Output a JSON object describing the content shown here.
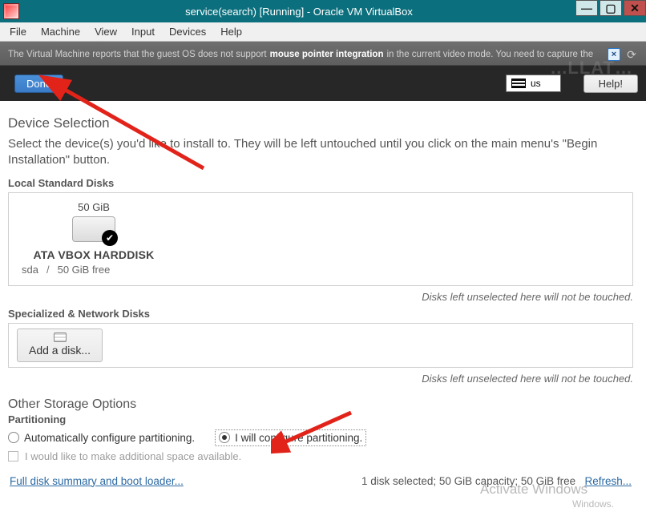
{
  "window": {
    "title": "service(search) [Running] - Oracle VM VirtualBox",
    "controls": {
      "min": "—",
      "max": "▢",
      "close": "✕"
    }
  },
  "menubar": {
    "items": [
      "File",
      "Machine",
      "View",
      "Input",
      "Devices",
      "Help"
    ]
  },
  "infobar": {
    "pre": "The Virtual Machine reports that the guest OS does not support ",
    "bold": "mouse pointer integration",
    "post": " in the current video mode. You need to capture the"
  },
  "faint_header": "...LLAT…",
  "installer_header": {
    "done": "Done",
    "keyboard_lang": "us",
    "help": "Help!"
  },
  "device_selection": {
    "title": "Device Selection",
    "desc": "Select the device(s) you'd like to install to.  They will be left untouched until you click on the main menu's \"Begin Installation\" button.",
    "local_title": "Local Standard Disks",
    "disk": {
      "size": "50 GiB",
      "name": "ATA VBOX HARDDISK",
      "dev": "sda",
      "sep": "/",
      "free": "50 GiB free"
    },
    "unselected_note": "Disks left unselected here will not be touched.",
    "specialized_title": "Specialized & Network Disks",
    "add_disk": "Add a disk..."
  },
  "other_storage": {
    "title": "Other Storage Options",
    "partitioning_title": "Partitioning",
    "auto_label": "Automatically configure partitioning.",
    "manual_label": "I will configure partitioning.",
    "additional_space": "I would like to make additional space available."
  },
  "footer": {
    "summary_link": "Full disk summary and boot loader...",
    "status_prefix": "1 disk selected; ",
    "status_capacity": "50 GiB capacity; ",
    "status_free": "50 GiB free",
    "refresh": "Refresh..."
  },
  "watermark": {
    "line1": "Activate Windows",
    "line2": "Windows."
  }
}
